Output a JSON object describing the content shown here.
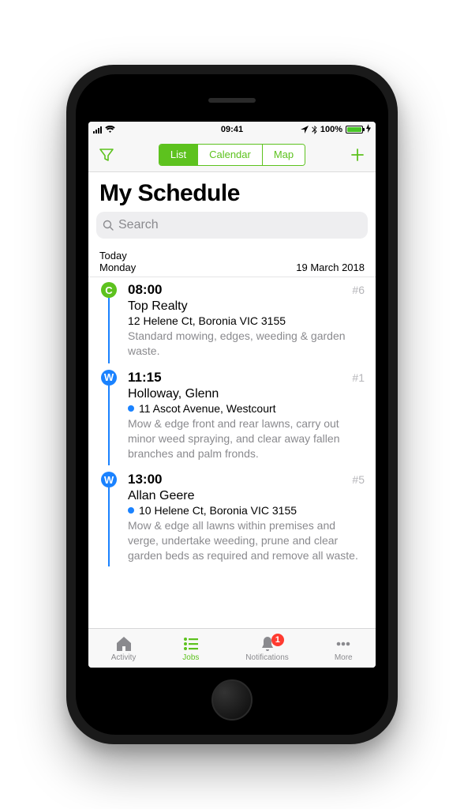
{
  "status": {
    "time": "09:41",
    "battery_pct": "100%"
  },
  "nav": {
    "segments": {
      "list": "List",
      "calendar": "Calendar",
      "map": "Map"
    }
  },
  "title": "My Schedule",
  "search": {
    "placeholder": "Search"
  },
  "date_header": {
    "relative": "Today",
    "weekday": "Monday",
    "date": "19 March 2018"
  },
  "jobs": [
    {
      "marker": "C",
      "marker_color": "green",
      "time": "08:00",
      "number": "#6",
      "client": "Top Realty",
      "address": "12 Helene Ct, Boronia VIC 3155",
      "dot": false,
      "desc": "Standard mowing, edges, weeding & garden waste."
    },
    {
      "marker": "W",
      "marker_color": "blue",
      "time": "11:15",
      "number": "#1",
      "client": "Holloway, Glenn",
      "address": "11 Ascot Avenue, Westcourt",
      "dot": true,
      "desc": "Mow & edge front and rear lawns, carry out minor weed spraying, and clear away fallen branches and palm fronds."
    },
    {
      "marker": "W",
      "marker_color": "blue",
      "time": "13:00",
      "number": "#5",
      "client": "Allan Geere",
      "address": "10 Helene Ct, Boronia VIC 3155",
      "dot": true,
      "desc": "Mow & edge all lawns within premises and verge, undertake weeding, prune and clear garden beds as required and remove all waste."
    }
  ],
  "tabs": {
    "activity": "Activity",
    "jobs": "Jobs",
    "notifications": "Notifications",
    "more": "More",
    "notif_count": "1"
  }
}
